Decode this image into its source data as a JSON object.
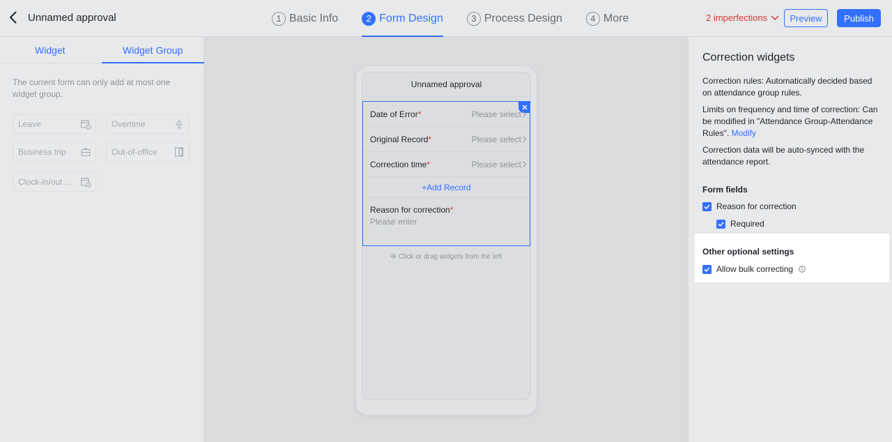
{
  "header": {
    "title": "Unnamed approval",
    "steps": [
      {
        "num": "1",
        "label": "Basic Info"
      },
      {
        "num": "2",
        "label": "Form Design"
      },
      {
        "num": "3",
        "label": "Process Design"
      },
      {
        "num": "4",
        "label": "More"
      }
    ],
    "imperfections": "2 imperfections",
    "preview_label": "Preview",
    "publish_label": "Publish"
  },
  "left": {
    "tabs": [
      "Widget",
      "Widget Group"
    ],
    "hint": "The current form can only add at most one widget group.",
    "widgets": [
      {
        "label": "Leave",
        "icon": "calendar-clock-icon"
      },
      {
        "label": "Overtime",
        "icon": "lamp-icon"
      },
      {
        "label": "Business trip",
        "icon": "suitcase-icon"
      },
      {
        "label": "Out-of-office",
        "icon": "door-icon"
      },
      {
        "label": "Clock-in/out ...",
        "icon": "calendar-clock-icon"
      }
    ]
  },
  "form": {
    "title": "Unnamed approval",
    "rows": [
      {
        "label": "Date of Error",
        "value": "Please select"
      },
      {
        "label": "Original Record",
        "value": "Please select"
      },
      {
        "label": "Correction time",
        "value": "Please select"
      }
    ],
    "add_record": "+Add Record",
    "reason_label": "Reason for correction",
    "reason_placeholder": "Please enter",
    "required_mark": "*",
    "drag_hint": "✣ Click or drag widgets from the left"
  },
  "right": {
    "title": "Correction widgets",
    "rules_text": "Correction rules: Automatically decided based on attendance group rules.",
    "limits_text": "Limits on frequency and time of correction: Can be modified in \"Attendance Group-Attendance Rules\".",
    "modify_link": "Modify",
    "sync_text": "Correction data will be auto-synced with the attendance report.",
    "form_fields_title": "Form fields",
    "reason_checkbox": "Reason for correction",
    "required_checkbox": "Required",
    "other_title": "Other optional settings",
    "bulk_checkbox": "Allow bulk correcting"
  },
  "colors": {
    "accent": "#3370ff",
    "error": "#d83931"
  }
}
